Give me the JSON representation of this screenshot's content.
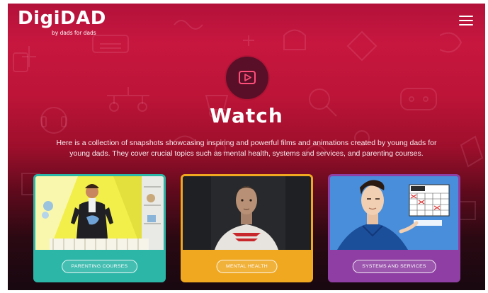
{
  "header": {
    "logo_text": "DigiDAD",
    "logo_tagline": "by dads for dads",
    "menu_icon": "hamburger-menu-icon"
  },
  "hero": {
    "icon": "play-button-icon",
    "title": "Watch",
    "description": "Here is a collection of snapshots showcasing inspiring and powerful films and animations created by young dads for young dads. They cover crucial topics such as mental health, systems and services, and parenting courses."
  },
  "cards": [
    {
      "label": "PARENTING COURSES",
      "color": "#2cb6a8"
    },
    {
      "label": "MENTAL HEALTH",
      "color": "#f0a821"
    },
    {
      "label": "SYSTEMS AND SERVICES",
      "color": "#8f3fa3"
    }
  ],
  "colors": {
    "background_top": "#c7173f",
    "background_bottom": "#180810",
    "play_circle": "#5a0f28",
    "play_icon": "#ff4f7a"
  }
}
